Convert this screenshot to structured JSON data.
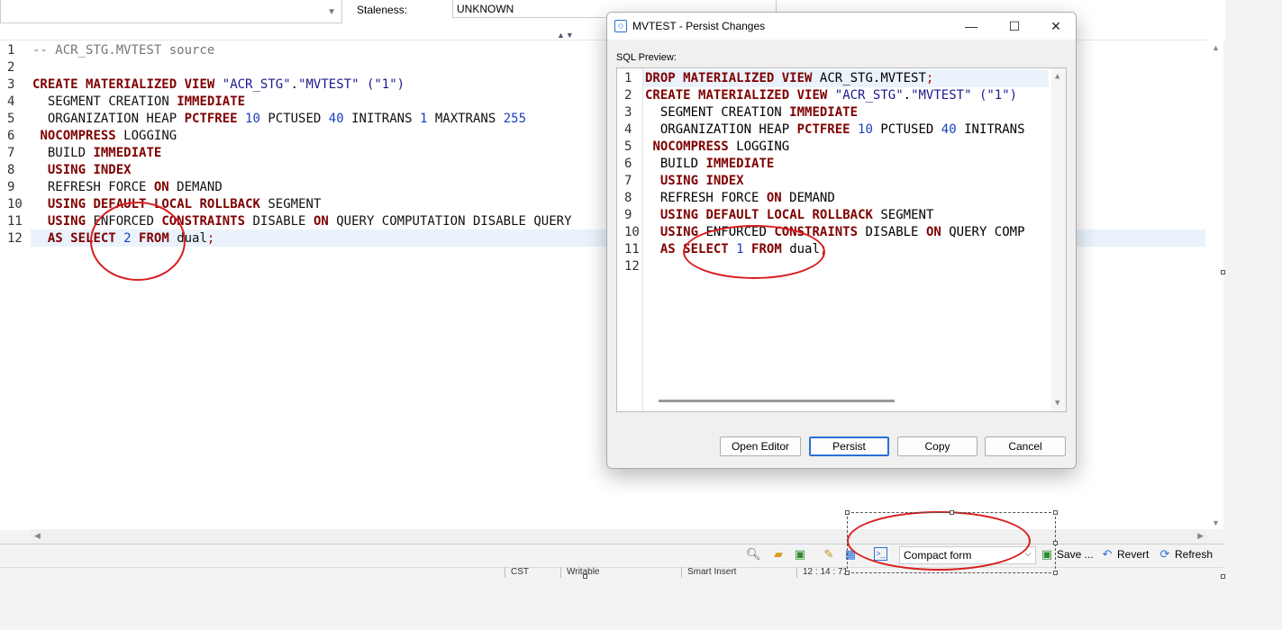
{
  "top": {
    "staleness_label": "Staleness:",
    "staleness_value": "UNKNOWN"
  },
  "editor": {
    "lines": [
      {
        "n": "1"
      },
      {
        "n": "2"
      },
      {
        "n": "3"
      },
      {
        "n": "4"
      },
      {
        "n": "5"
      },
      {
        "n": "6"
      },
      {
        "n": "7"
      },
      {
        "n": "8"
      },
      {
        "n": "9"
      },
      {
        "n": "10"
      },
      {
        "n": "11"
      },
      {
        "n": "12"
      }
    ],
    "highlighted_line": "12",
    "tokens": {
      "l1": "-- ACR_STG.MVTEST source",
      "create": "CREATE",
      "materialized": "MATERIALIZED",
      "view": "VIEW",
      "owner": "\"ACR_STG\"",
      "dot": ".",
      "name": "\"MVTEST\"",
      "cols": "(\"1\")",
      "segment": "SEGMENT",
      "creation": "CREATION",
      "immediate": "IMMEDIATE",
      "organization_heap": "ORGANIZATION HEAP",
      "pctfree": "PCTFREE",
      "n10": "10",
      "pctused": "PCTUSED",
      "n40": "40",
      "initrans": "INITRANS",
      "n1": "1",
      "maxtrans": "MAXTRANS",
      "n255": "255",
      "nocompress": "NOCOMPRESS",
      "logging": "LOGGING",
      "build": "BUILD",
      "using": "USING",
      "index": "INDEX",
      "refresh_force": "REFRESH FORCE",
      "on": "ON",
      "demand": "DEMAND",
      "default": "DEFAULT",
      "local": "LOCAL",
      "rollback": "ROLLBACK",
      "enforced": "ENFORCED",
      "constraints": "CONSTRAINTS",
      "disable_query_comp": "DISABLE",
      "query_computation_disable_query": "QUERY COMPUTATION DISABLE QUERY",
      "as": "AS",
      "select": "SELECT",
      "n2": "2",
      "from": "FROM",
      "dual": "dual",
      "semi": ";"
    }
  },
  "toolbar": {
    "form_combo_value": "Compact form",
    "save_label": "Save ...",
    "revert_label": "Revert",
    "refresh_label": "Refresh",
    "icons": [
      "search-icon",
      "open-folder-icon",
      "save-disk-icon",
      "edit-icon",
      "grid-icon",
      "terminal-icon"
    ]
  },
  "statusbar": {
    "segments": [
      "CST",
      "Writable",
      "Smart Insert",
      "12 : 14 : 71"
    ]
  },
  "dialog": {
    "title": "MVTEST - Persist Changes",
    "sql_preview_label": "SQL Preview:",
    "line_numbers": [
      "1",
      "2",
      "3",
      "4",
      "5",
      "6",
      "7",
      "8",
      "9",
      "10",
      "11",
      "12"
    ],
    "tokens": {
      "drop": "DROP",
      "materialized": "MATERIALIZED",
      "view": "VIEW",
      "target": "ACR_STG.MVTEST",
      "semi": ";",
      "create": "CREATE",
      "owner": "\"ACR_STG\"",
      "dot": ".",
      "name": "\"MVTEST\"",
      "cols": "(\"1\")",
      "segment_creation": "SEGMENT CREATION",
      "immediate": "IMMEDIATE",
      "organization_heap": "ORGANIZATION HEAP",
      "pctfree": "PCTFREE",
      "n10": "10",
      "pctused": "PCTUSED",
      "n40": "40",
      "initrans": "INITRANS",
      "nocompress": "NOCOMPRESS",
      "logging": "LOGGING",
      "build": "BUILD",
      "using": "USING",
      "index": "INDEX",
      "refresh_force": "REFRESH FORCE",
      "on": "ON",
      "demand": "DEMAND",
      "default": "DEFAULT",
      "local": "LOCAL",
      "rollback": "ROLLBACK",
      "segment": "SEGMENT",
      "enforced": "ENFORCED",
      "constraints": "CONSTRAINTS",
      "disable": "DISABLE",
      "query_comp": "QUERY COMP",
      "as": "AS",
      "select": "SELECT",
      "n1": "1",
      "from": "FROM",
      "dual": "dual"
    },
    "buttons": {
      "open_editor": "Open Editor",
      "persist": "Persist",
      "copy": "Copy",
      "cancel": "Cancel"
    }
  },
  "colors": {
    "keyword": "#7f0000",
    "annotation": "#d81e1e",
    "line_highlight": "#eaf2fb"
  }
}
